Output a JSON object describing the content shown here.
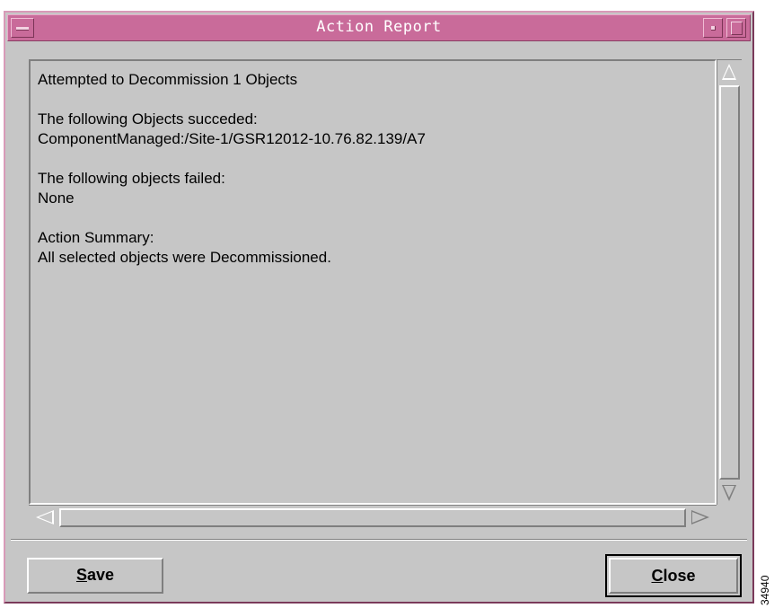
{
  "window": {
    "title": "Action Report"
  },
  "report": {
    "lines": [
      "Attempted to Decommission 1 Objects",
      "",
      "The following Objects succeded:",
      "ComponentManaged:/Site-1/GSR12012-10.76.82.139/A7",
      "",
      "The following objects failed:",
      "None",
      "",
      "Action Summary:",
      "All selected objects were Decommissioned."
    ]
  },
  "buttons": {
    "save": {
      "mnemonic": "S",
      "rest": "ave"
    },
    "close": {
      "mnemonic": "C",
      "rest": "lose"
    }
  },
  "figure_id": "34940",
  "colors": {
    "titlebar": "#c96b9a",
    "window_bg": "#c6c6c6"
  }
}
